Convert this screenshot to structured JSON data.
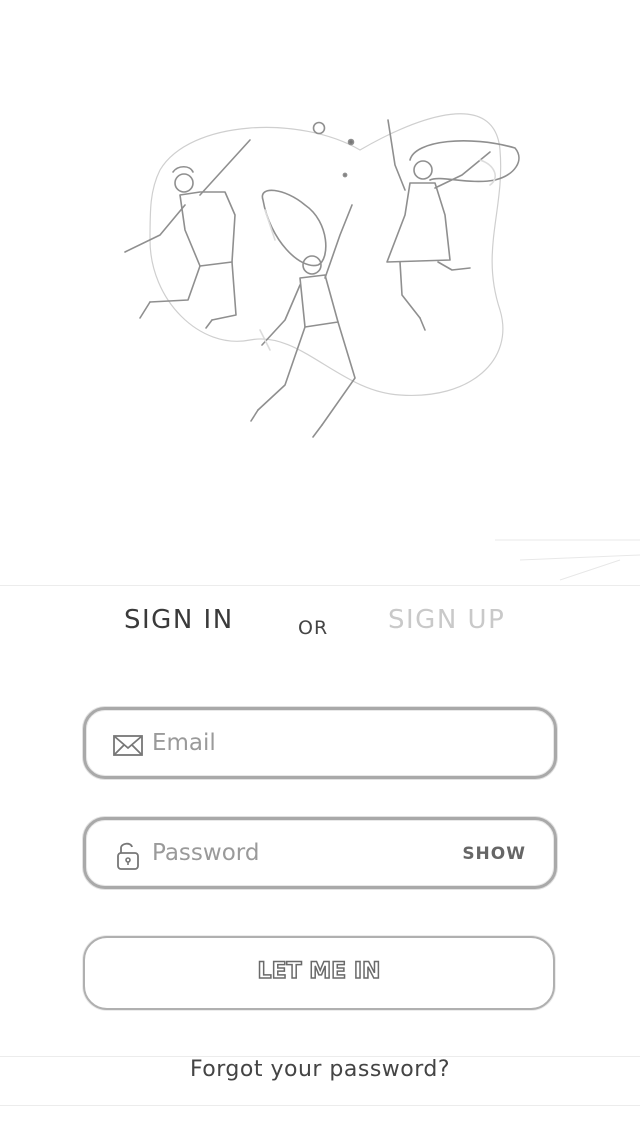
{
  "tabs": {
    "sign_in": "SIGN IN",
    "or": "OR",
    "sign_up": "SIGN UP"
  },
  "email_field": {
    "placeholder": "Email",
    "value": ""
  },
  "password_field": {
    "placeholder": "Password",
    "value": "",
    "show_label": "SHOW"
  },
  "submit": {
    "label": "LET ME IN"
  },
  "forgot_link": {
    "label": "Forgot your password?"
  },
  "icons": {
    "email": "envelope-icon",
    "password": "lock-icon"
  },
  "colors": {
    "active_tab": "#3a3a3a",
    "inactive_tab": "#c9c9c9",
    "field_border": "#a9a9a9"
  }
}
